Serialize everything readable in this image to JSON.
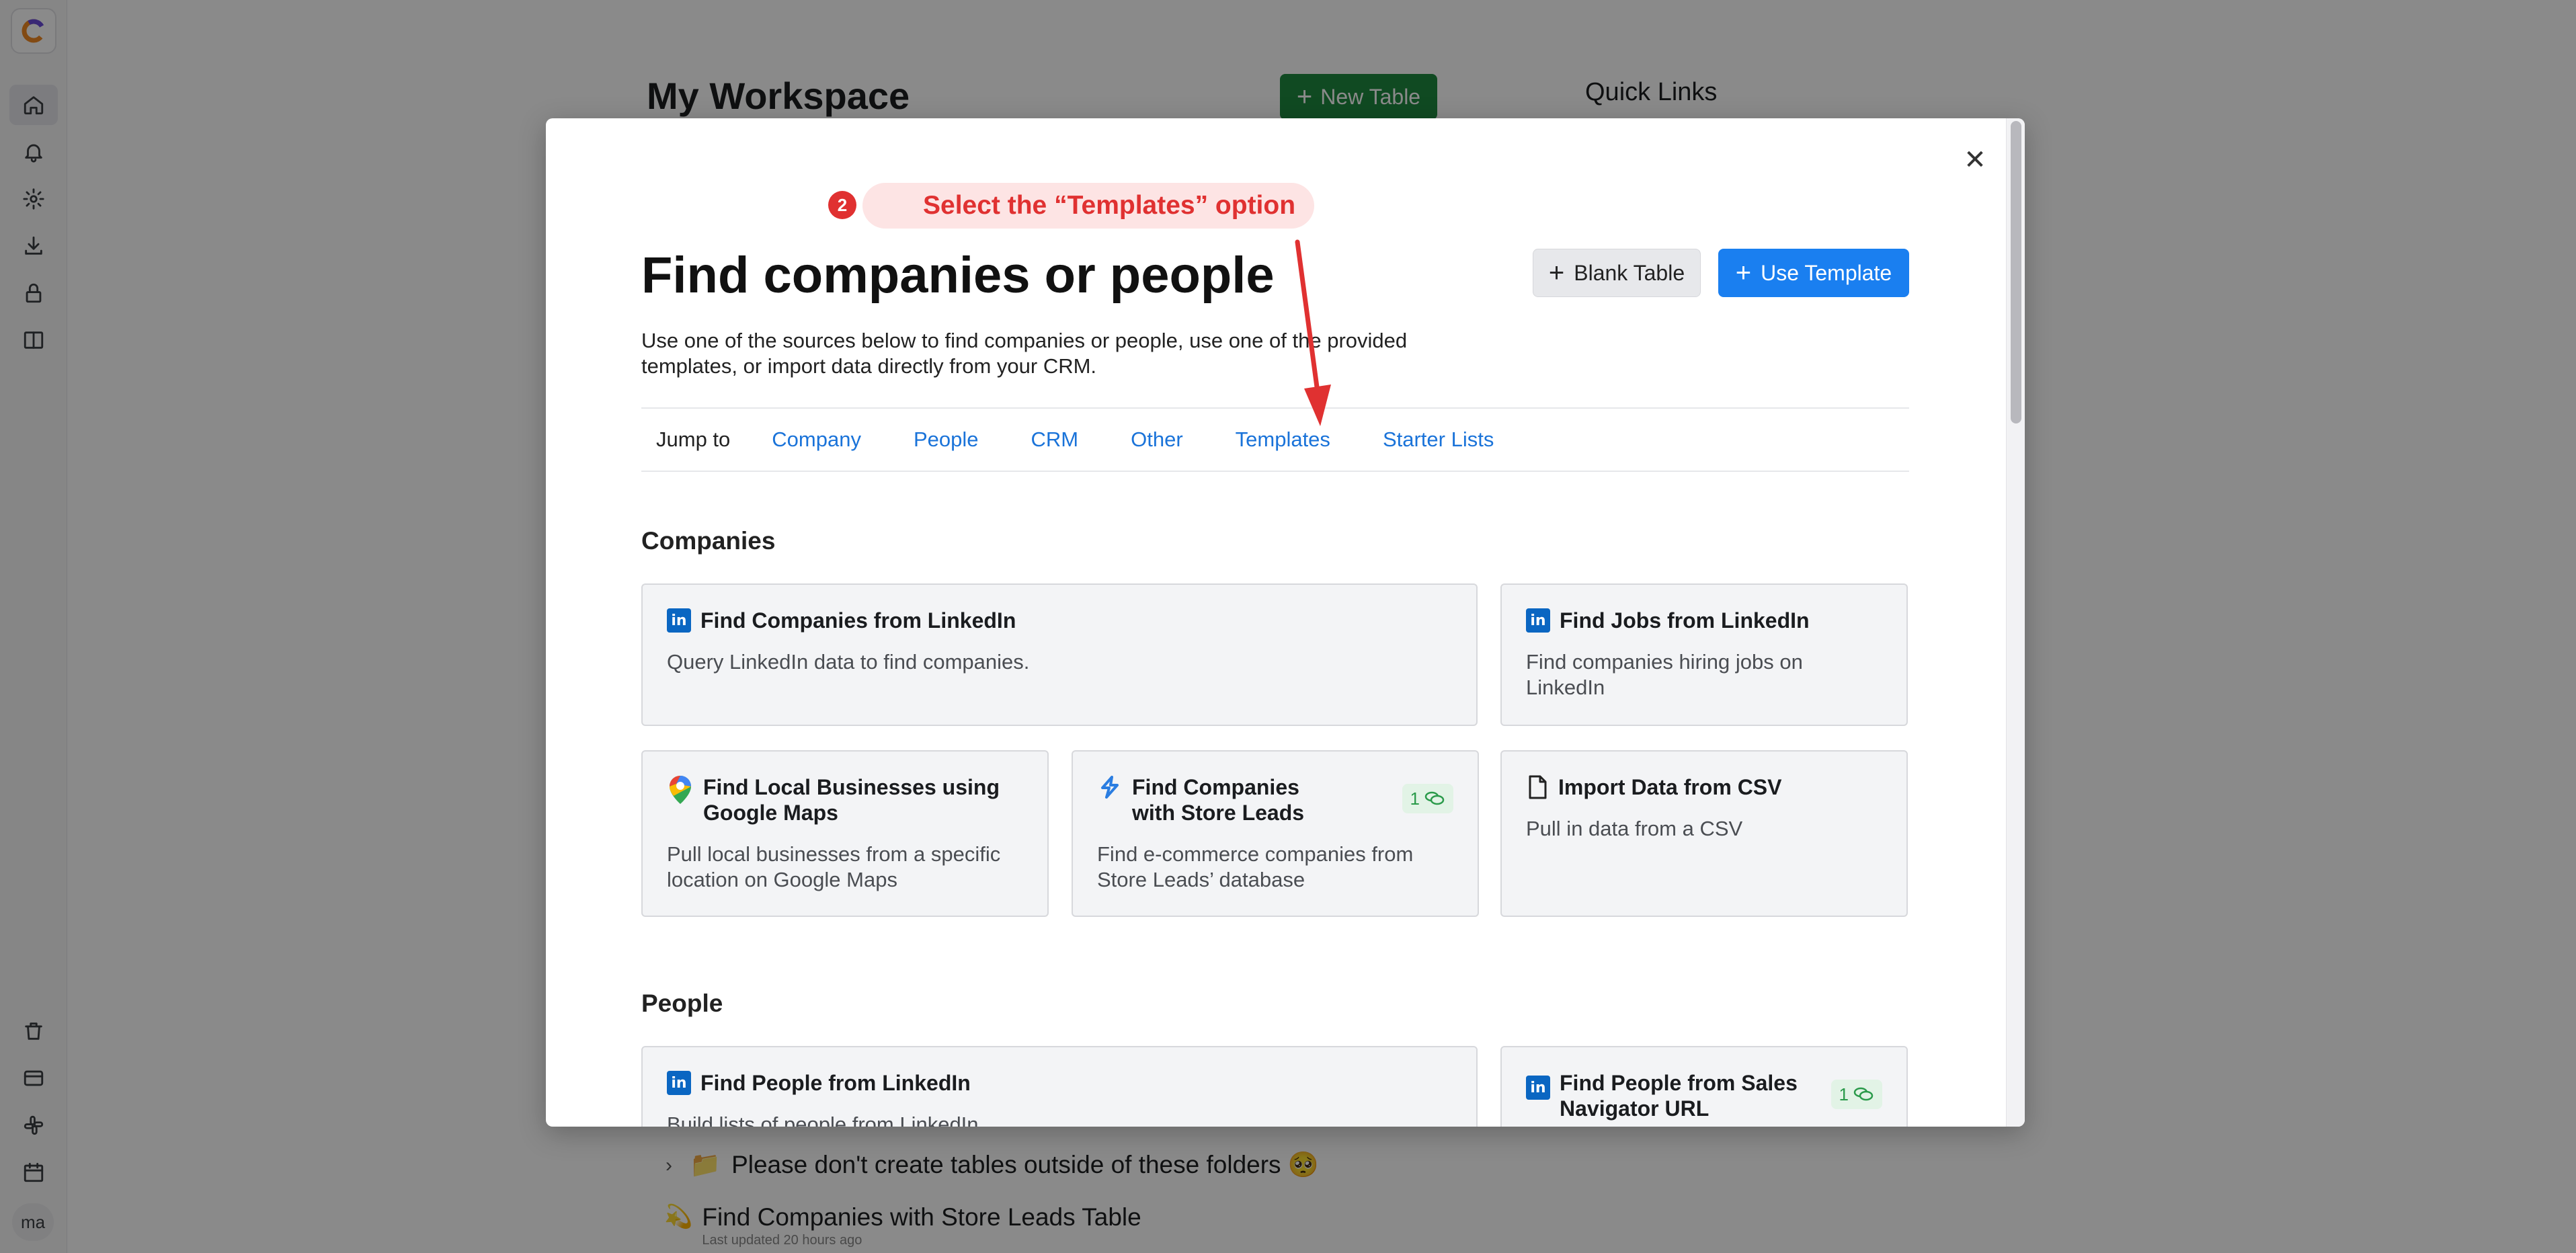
{
  "sidebar": {
    "items": [
      {
        "icon": "home-icon"
      },
      {
        "icon": "bell-icon"
      },
      {
        "icon": "gear-icon"
      },
      {
        "icon": "download-icon"
      },
      {
        "icon": "lock-icon"
      },
      {
        "icon": "book-icon"
      },
      {
        "icon": "trash-icon"
      },
      {
        "icon": "credit-card-icon"
      },
      {
        "icon": "slack-icon"
      },
      {
        "icon": "calendar-icon"
      }
    ],
    "avatar": "ma"
  },
  "background": {
    "title": "My Workspace",
    "new_table_label": "New Table",
    "quick_links": "Quick Links",
    "folder": {
      "label": "Please don't create tables outside of these folders 🥺",
      "emoji": "📁"
    },
    "table": {
      "emoji": "💫",
      "name": "Find Companies with Store Leads Table",
      "updated": "Last updated 20 hours ago"
    }
  },
  "annotation": {
    "number": "2",
    "text": "Select the “Templates” option",
    "color": "#e03131"
  },
  "modal": {
    "title": "Find companies or people",
    "description": "Use one of the sources below to find companies or people, use one of the provided templates, or import data directly from your CRM.",
    "blank_table_label": "Blank Table",
    "use_template_label": "Use Template",
    "jump_label": "Jump to",
    "jump_links": [
      "Company",
      "People",
      "CRM",
      "Other",
      "Templates",
      "Starter Lists"
    ],
    "sections": {
      "companies": "Companies",
      "people": "People"
    },
    "cards": [
      {
        "title": "Find Companies from LinkedIn",
        "desc": "Query LinkedIn data to find companies.",
        "icon": "linkedin-icon"
      },
      {
        "title": "Find Jobs from LinkedIn",
        "desc": "Find companies hiring jobs on LinkedIn",
        "icon": "linkedin-icon"
      },
      {
        "title": "Find Local Businesses using Google Maps",
        "desc": "Pull local businesses from a specific location on Google Maps",
        "icon": "google-maps-icon"
      },
      {
        "title": "Find Companies with Store Leads",
        "desc": "Find e-commerce companies from Store Leads’ database",
        "icon": "store-leads-icon",
        "credits": "1"
      },
      {
        "title": "Import Data from CSV",
        "desc": "Pull in data from a CSV",
        "icon": "file-icon"
      },
      {
        "title": "Find People from LinkedIn",
        "desc": "Build lists of people from LinkedIn",
        "icon": "linkedin-icon"
      },
      {
        "title": "Find People from Sales Navigator URL",
        "desc": "",
        "icon": "linkedin-icon",
        "credits": "1"
      }
    ],
    "colors": {
      "primary": "#1a7ff0",
      "link": "#1a73d9",
      "linkedin": "#0a66c2",
      "credit_green": "#2a9a4a"
    }
  }
}
